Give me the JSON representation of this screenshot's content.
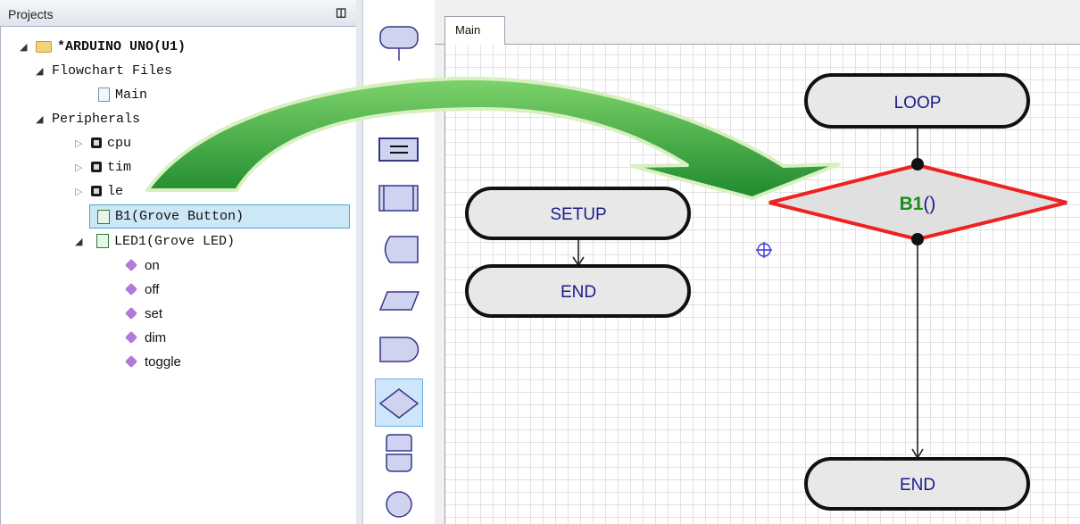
{
  "projects_panel": {
    "title": "Projects",
    "tree": {
      "root": "*ARDUINO UNO(U1)",
      "flowchart_files": "Flowchart Files",
      "main_file": "Main",
      "peripherals": "Peripherals",
      "cpu": "cpu",
      "timer_partial": "tim",
      "led_partial": "le",
      "b1": "B1(Grove Button)",
      "led1": "LED1(Grove LED)",
      "led1_methods": [
        "on",
        "off",
        "set",
        "dim",
        "toggle"
      ]
    }
  },
  "editor": {
    "tab": "Main",
    "blocks": {
      "loop": "LOOP",
      "setup": "SETUP",
      "end_setup": "END",
      "end_loop": "END",
      "decision_name": "B1",
      "decision_parens": "()"
    }
  },
  "colors": {
    "terminator_fill": "#e8e8e8",
    "terminator_text": "#1a1a8c",
    "decision_border": "#ee2222",
    "decision_name": "#1a8c1a",
    "arrow_green": "#3fae3f",
    "tool_fill": "#cfd3ef",
    "tool_stroke": "#36368a"
  }
}
